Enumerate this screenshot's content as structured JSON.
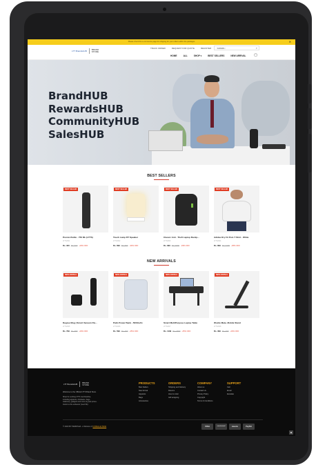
{
  "promo": {
    "text": "Please check the e-commerce page for shipping for your orders within the packages",
    "close": "✕"
  },
  "header": {
    "logo_left": "LTT BrandsHUB",
    "logo_right_1": "BRAND",
    "logo_right_2": "STORE",
    "top_links": [
      "TRACK ORDER",
      "REQUEST FOR QUOTE",
      "REGISTER",
      "LOGIN"
    ],
    "search_placeholder": "SEARCH",
    "nav": [
      "HOME",
      "ALL",
      "SHOP ▾",
      "BEST SELLERS",
      "NEW ARRIVAL"
    ]
  },
  "hero": {
    "lines": [
      "BrandHUB",
      "RewardsHUB",
      "CommunityHUB",
      "SalesHUB"
    ]
  },
  "best_sellers": {
    "title": "BEST SELLERS",
    "items": [
      {
        "badge": "BEST SELLER",
        "name": "Premio Bottle - 750 ML (LTTS)",
        "cat": "LTTS/001",
        "now": "Rs. 320",
        "was": "Rs. 400",
        "off": "-20% OFF"
      },
      {
        "badge": "BEST SELLER",
        "name": "Touch Lamp BT Speaker",
        "cat": "LTTS/002",
        "now": "Rs. 699",
        "was": "Rs. 999",
        "off": "-30% OFF"
      },
      {
        "badge": "BEST SELLER",
        "name": "Classic Anti - Theft Laptop Backp...",
        "cat": "LTTS/003",
        "now": "Rs. 999",
        "was": "Rs. 1500",
        "off": "-33% OFF"
      },
      {
        "badge": "BEST SELLER",
        "name": "Adidas Dry Fit Polo T Shirt - White",
        "cat": "LTTS/004",
        "now": "Rs. 899",
        "was": "Rs. 1200",
        "off": "-25% OFF"
      }
    ]
  },
  "new_arrivals": {
    "title": "NEW ARRIVALS",
    "items": [
      {
        "badge": "NEW ARRIVAL",
        "name": "Degree Mug | Smart Vacuum Fla...",
        "cat": "LTTS/005",
        "now": "Rs. 799",
        "was": "Rs. 999",
        "off": "-20% OFF"
      },
      {
        "badge": "NEW ARRIVAL",
        "name": "Palm Power Bank - 5000mAh",
        "cat": "LTTS/006",
        "now": "Rs. 599",
        "was": "Rs. 799",
        "off": "-25% OFF"
      },
      {
        "badge": "NEW ARRIVAL",
        "name": "Smart MultiPurpose Laptop Table",
        "cat": "LTTS/007",
        "now": "Rs. 1199",
        "was": "Rs. 1599",
        "off": "-25% OFF"
      },
      {
        "badge": "NEW ARRIVAL",
        "name": "Wozile Mate- Mobile Stand",
        "cat": "LTTS/008",
        "now": "Rs. 399",
        "was": "Rs. 499",
        "off": "-20% OFF"
      }
    ]
  },
  "footer": {
    "logo_left": "LTT BrandsHUB",
    "logo_right_1": "BRAND",
    "logo_right_2": "STORE",
    "welcome": "Welcome to the Official LTTS Brand Store.",
    "desc": "Shop for exciting LTTS merchandise, including apparels, drinkware, bags, stationery, gadgets and more at great prices. Assist us the endeavor (Leet FE).",
    "columns": [
      {
        "title": "PRODUCTS",
        "items": [
          "Best Sellers",
          "New Arrival",
          "Apparels",
          "Bags",
          "Accessories"
        ]
      },
      {
        "title": "ORDERS",
        "items": [
          "Shipping and Delivery",
          "Returns",
          "How to order",
          "Gift wrapping"
        ]
      },
      {
        "title": "COMPANY",
        "items": [
          "About us",
          "Contact Us",
          "Privacy Policy",
          "Copyright",
          "Terms & Conditions"
        ]
      },
      {
        "title": "SUPPORT",
        "items": [
          "Call",
          "Email",
          "Escalate"
        ]
      }
    ],
    "copyright": "© 2023 BY PERIKSHA  ·  A Division of",
    "copyright_link": "CORELLE INDIA",
    "payments": [
      "VISA",
      "mastercard",
      "maestro",
      "PayPal"
    ],
    "to_top": "▲"
  }
}
